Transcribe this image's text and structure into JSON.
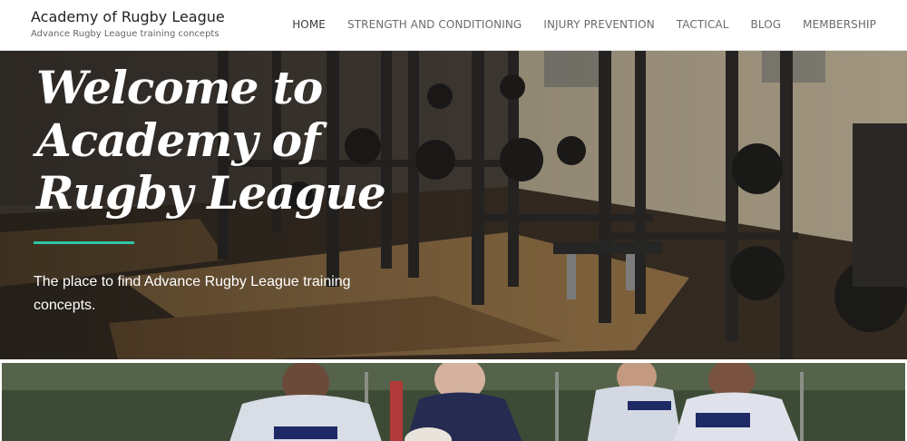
{
  "site": {
    "title": "Academy of Rugby League",
    "tagline": "Advance Rugby League training concepts"
  },
  "nav": {
    "items": [
      {
        "label": "HOME",
        "active": true
      },
      {
        "label": "STRENGTH AND CONDITIONING",
        "active": false
      },
      {
        "label": "INJURY PREVENTION",
        "active": false
      },
      {
        "label": "TACTICAL",
        "active": false
      },
      {
        "label": "BLOG",
        "active": false
      },
      {
        "label": "MEMBERSHIP",
        "active": false
      }
    ]
  },
  "hero": {
    "title": "Welcome to Academy of Rugby League",
    "subtitle": " The place to find Advance Rugby League training concepts.",
    "accent_color": "#2ec4a6"
  }
}
